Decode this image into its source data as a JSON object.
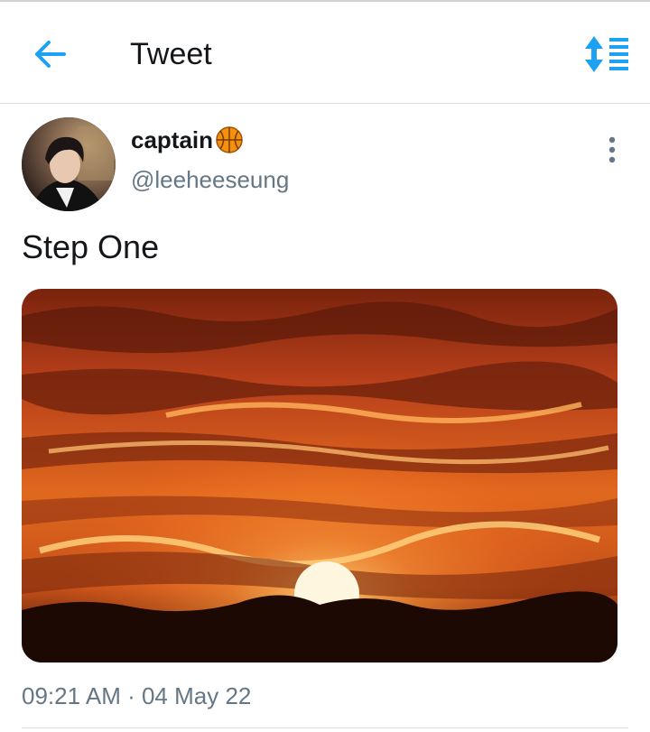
{
  "header": {
    "title": "Tweet",
    "back_icon": "arrow-left-icon",
    "sort_icon": "sort-arrows-icon",
    "accent_color": "#1da1f2"
  },
  "tweet": {
    "author_name": "captain",
    "author_emoji_icon": "basketball-icon",
    "author_handle": "@leeheeseung",
    "text": "Step One",
    "media_description_icon": "sunset-photo",
    "timestamp": "09:21 AM · 04 May 22",
    "more_icon": "more-vertical-icon"
  },
  "colors": {
    "text_primary": "#14171a",
    "text_secondary": "#657786",
    "divider": "#d9dde0"
  }
}
